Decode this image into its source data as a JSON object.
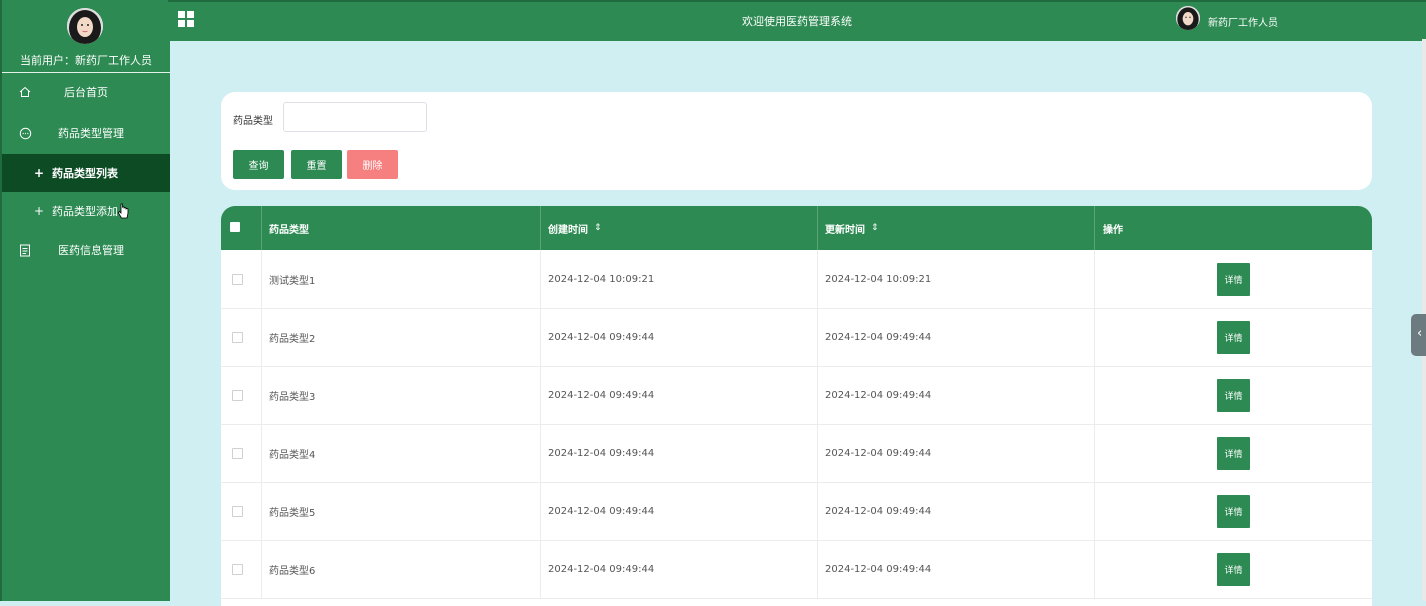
{
  "sidebar": {
    "current_user": "当前用户：新药厂工作人员",
    "items": [
      {
        "label": "后台首页",
        "icon": "home-icon"
      },
      {
        "label": "药品类型管理",
        "icon": "chat-icon"
      },
      {
        "label": "药品类型列表",
        "icon": "plus-icon",
        "active": true
      },
      {
        "label": "药品类型添加",
        "icon": "plus-icon"
      },
      {
        "label": "医药信息管理",
        "icon": "document-icon"
      }
    ]
  },
  "topbar": {
    "title": "欢迎使用医药管理系统",
    "user": "新药厂工作人员"
  },
  "search": {
    "label": "药品类型",
    "input_value": "",
    "query_label": "查询",
    "reset_label": "重置",
    "delete_label": "删除"
  },
  "table": {
    "columns": [
      "药品类型",
      "创建时间",
      "更新时间",
      "操作"
    ],
    "sort_glyph": "⇕",
    "detail_label": "详情",
    "rows": [
      {
        "type": "测试类型1",
        "created": "2024-12-04 10:09:21",
        "updated": "2024-12-04 10:09:21"
      },
      {
        "type": "药品类型2",
        "created": "2024-12-04 09:49:44",
        "updated": "2024-12-04 09:49:44"
      },
      {
        "type": "药品类型3",
        "created": "2024-12-04 09:49:44",
        "updated": "2024-12-04 09:49:44"
      },
      {
        "type": "药品类型4",
        "created": "2024-12-04 09:49:44",
        "updated": "2024-12-04 09:49:44"
      },
      {
        "type": "药品类型5",
        "created": "2024-12-04 09:49:44",
        "updated": "2024-12-04 09:49:44"
      },
      {
        "type": "药品类型6",
        "created": "2024-12-04 09:49:44",
        "updated": "2024-12-04 09:49:44"
      }
    ]
  },
  "colors": {
    "primary": "#2c8a52",
    "active_menu": "#0d4b25",
    "danger": "#f67f7f",
    "background": "#cfeff2"
  }
}
